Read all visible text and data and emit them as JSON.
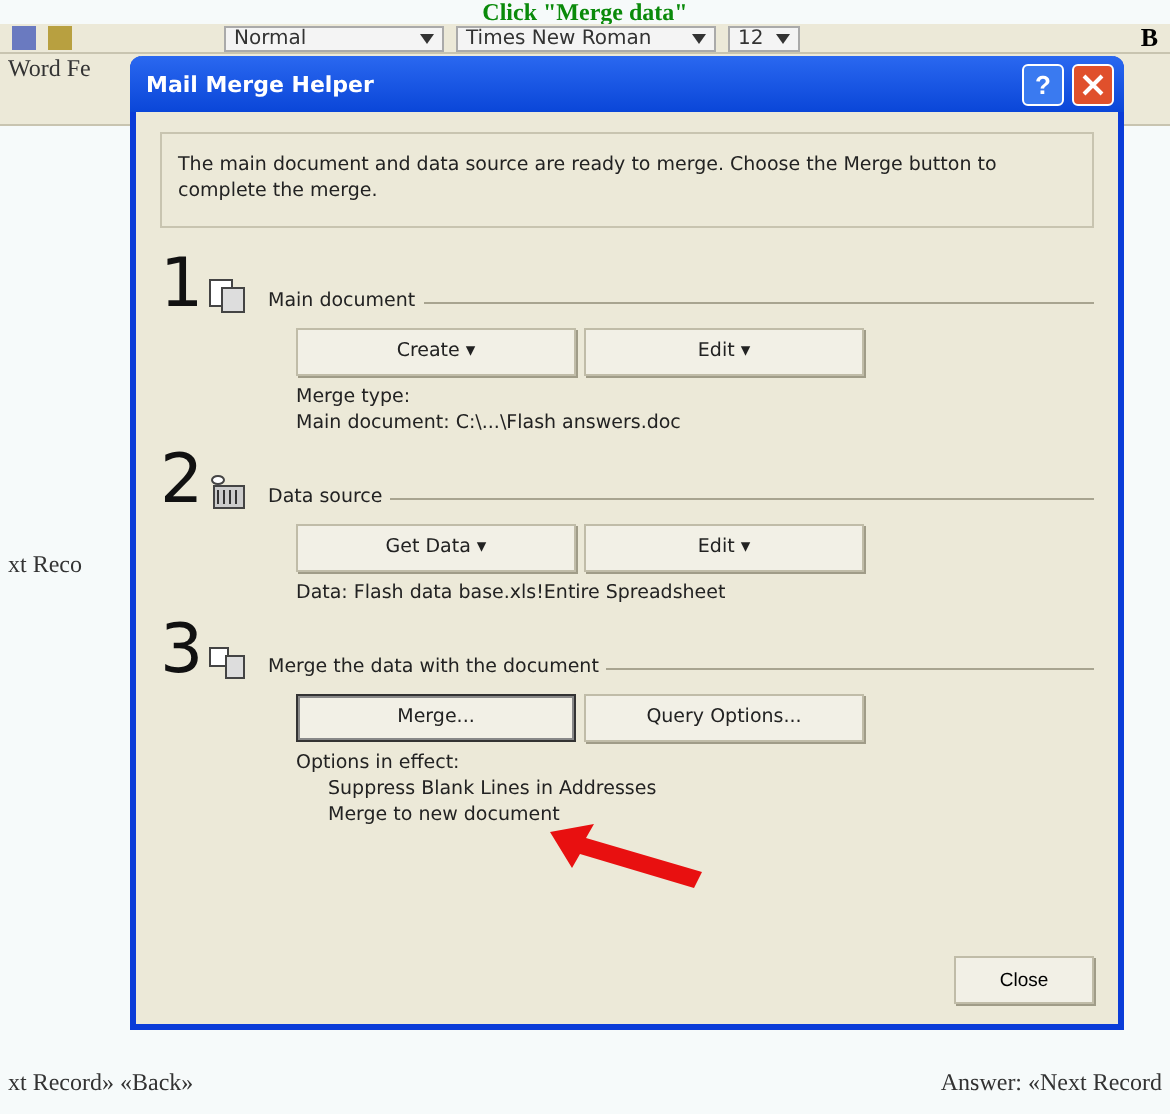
{
  "heading": "Click \"Merge data\"",
  "toolbar": {
    "style": "Normal",
    "font": "Times New Roman",
    "size": "12",
    "bold": "B"
  },
  "document": {
    "top_left": "Word Fe",
    "middle_left": "xt Reco",
    "bottom_left": "xt Record» «Back»",
    "bottom_right": "Answer: «Next Record"
  },
  "dialog": {
    "title": "Mail Merge Helper",
    "help": "?",
    "intro": "The main document and data source are ready to merge. Choose the Merge button to complete the merge.",
    "steps": [
      {
        "number": "1",
        "kind": "document",
        "label": "Main document",
        "buttons": [
          {
            "label": "Create ▾",
            "pressed": false
          },
          {
            "label": "Edit ▾",
            "pressed": false
          }
        ],
        "info": [
          "Merge type:",
          "Main document: C:\\...\\Flash answers.doc"
        ]
      },
      {
        "number": "2",
        "kind": "database",
        "label": "Data source",
        "buttons": [
          {
            "label": "Get Data ▾",
            "pressed": false
          },
          {
            "label": "Edit ▾",
            "pressed": false
          }
        ],
        "info": [
          "Data: Flash data base.xls!Entire Spreadsheet"
        ]
      },
      {
        "number": "3",
        "kind": "merge",
        "label": "Merge the data with the document",
        "buttons": [
          {
            "label": "Merge...",
            "pressed": true
          },
          {
            "label": "Query Options...",
            "pressed": false
          }
        ],
        "info": [
          "Options in effect:"
        ],
        "indented": [
          "Suppress Blank Lines in Addresses",
          "Merge to new document"
        ]
      }
    ],
    "close": "Close"
  }
}
